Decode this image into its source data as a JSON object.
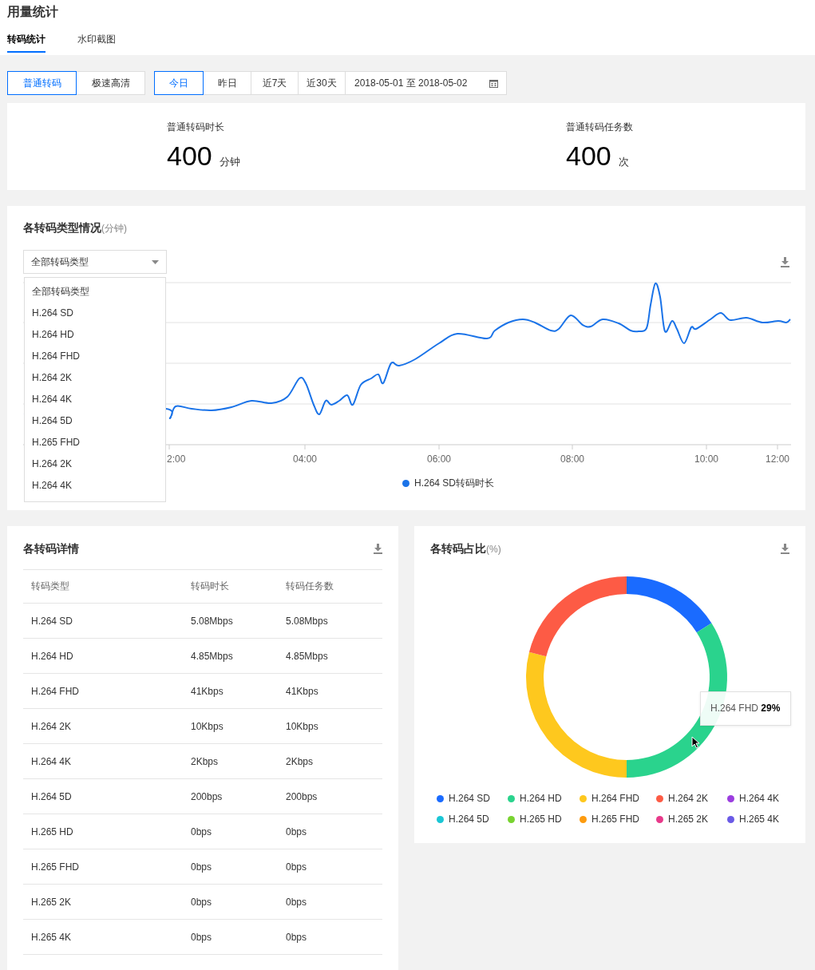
{
  "page_title": "用量统计",
  "tabs": [
    {
      "label": "转码统计",
      "selected": true
    },
    {
      "label": "水印截图",
      "selected": false
    }
  ],
  "mode_buttons": [
    {
      "label": "普通转码",
      "selected": true
    },
    {
      "label": "极速高清",
      "selected": false
    }
  ],
  "date_buttons": [
    {
      "label": "今日",
      "selected": true
    },
    {
      "label": "昨日",
      "selected": false
    },
    {
      "label": "近7天",
      "selected": false
    },
    {
      "label": "近30天",
      "selected": false
    }
  ],
  "date_range": {
    "value": "2018-05-01 至 2018-05-02"
  },
  "stats": [
    {
      "label": "普通转码时长",
      "value": "400",
      "unit": "分钟"
    },
    {
      "label": "普通转码任务数",
      "value": "400",
      "unit": "次"
    }
  ],
  "type_chart": {
    "title": "各转码类型情况",
    "unit": "(分钟)",
    "select": {
      "value": "全部转码类型",
      "expanded": true
    },
    "options": [
      "全部转码类型",
      "H.264 SD",
      "H.264 HD",
      "H.264 FHD",
      "H.264 2K",
      "H.264 4K",
      "H.264 5D",
      "H.265 FHD",
      "H.264 2K",
      "H.264 4K"
    ],
    "x_ticks": [
      "2:00",
      "04:00",
      "06:00",
      "08:00",
      "10:00",
      "12:00"
    ],
    "legend": {
      "label": "H.264 SD转码时长",
      "color": "#1a73e8"
    }
  },
  "detail_table": {
    "title": "各转码详情",
    "columns": [
      "转码类型",
      "转码时长",
      "转码任务数"
    ],
    "rows": [
      [
        "H.264 SD",
        "5.08Mbps",
        "5.08Mbps"
      ],
      [
        "H.264 HD",
        "4.85Mbps",
        "4.85Mbps"
      ],
      [
        "H.264 FHD",
        "41Kbps",
        "41Kbps"
      ],
      [
        "H.264 2K",
        "10Kbps",
        "10Kbps"
      ],
      [
        "H.264 4K",
        "2Kbps",
        "2Kbps"
      ],
      [
        "H.264 5D",
        "200bps",
        "200bps"
      ],
      [
        "H.265 HD",
        "0bps",
        "0bps"
      ],
      [
        "H.265 FHD",
        "0bps",
        "0bps"
      ],
      [
        "H.265 2K",
        "0bps",
        "0bps"
      ],
      [
        "H.265 4K",
        "0bps",
        "0bps"
      ]
    ]
  },
  "share_chart": {
    "title": "各转码占比",
    "unit": "(%)",
    "tooltip": "H.264 FHD **29%**",
    "legend": [
      {
        "label": "H.264 SD",
        "color": "#1a6bff"
      },
      {
        "label": "H.264 HD",
        "color": "#2ad38d"
      },
      {
        "label": "H.264 FHD",
        "color": "#fec81e"
      },
      {
        "label": "H.264 2K",
        "color": "#fd5b45"
      },
      {
        "label": "H.264 4K",
        "color": "#9b3ddf"
      },
      {
        "label": "H.264 5D",
        "color": "#1ac6d5"
      },
      {
        "label": "H.265 HD",
        "color": "#78d330"
      },
      {
        "label": "H.265 FHD",
        "color": "#fd9b0e"
      },
      {
        "label": "H.265 2K",
        "color": "#e8398a"
      },
      {
        "label": "H.265 4K",
        "color": "#6a5ae6"
      }
    ]
  }
}
